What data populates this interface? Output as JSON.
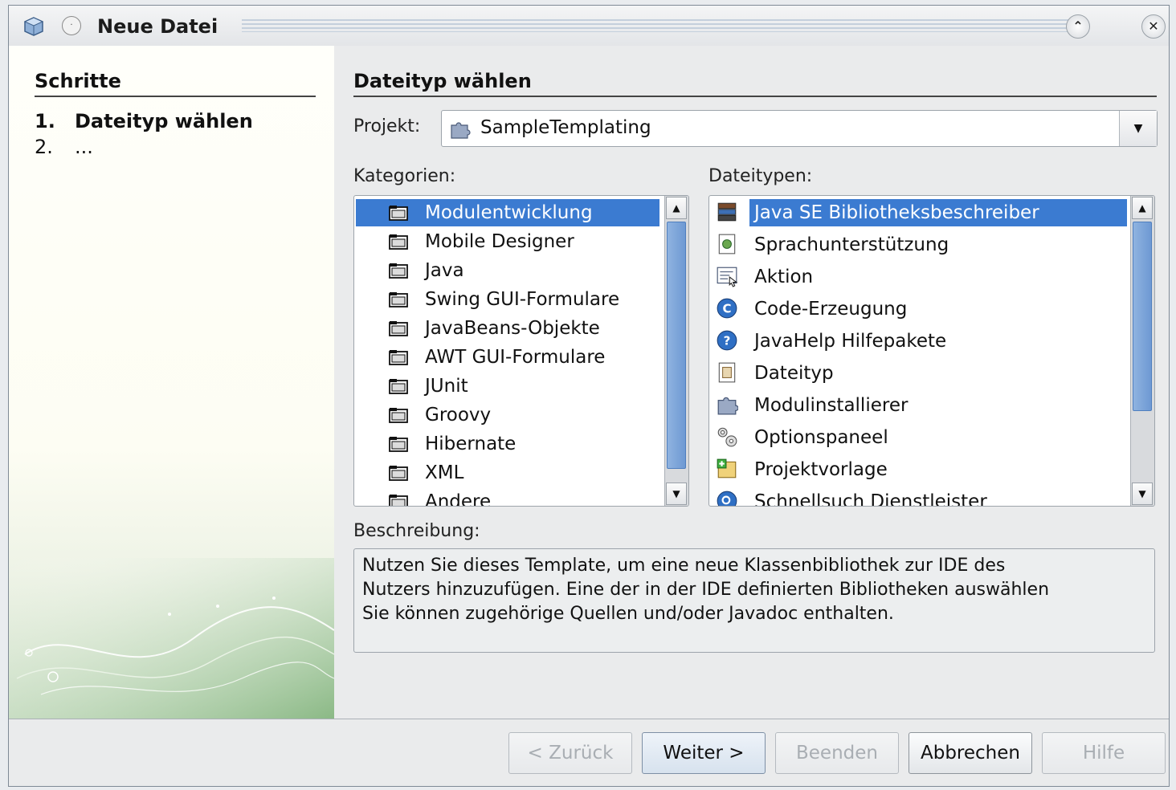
{
  "window": {
    "title": "Neue Datei",
    "minimize_symbol": "⌃",
    "close_symbol": "✕",
    "menu_symbol": "·"
  },
  "steps": {
    "heading": "Schritte",
    "items": [
      {
        "num": "1.",
        "label": "Dateityp wählen",
        "current": true
      },
      {
        "num": "2.",
        "label": "...",
        "current": false
      }
    ]
  },
  "main": {
    "heading": "Dateityp wählen",
    "project_label": "Projekt:",
    "project_value": "SampleTemplating",
    "categories_label": "Kategorien:",
    "categories": [
      "Modulentwicklung",
      "Mobile Designer",
      "Java",
      "Swing GUI-Formulare",
      "JavaBeans-Objekte",
      "AWT GUI-Formulare",
      "JUnit",
      "Groovy",
      "Hibernate",
      "XML",
      "Andere"
    ],
    "selected_category": "Modulentwicklung",
    "filetypes_label": "Dateitypen:",
    "filetypes": [
      {
        "label": "Java SE Bibliotheksbeschreiber",
        "icon": "books-icon"
      },
      {
        "label": "Sprachunterstützung",
        "icon": "language-file-icon"
      },
      {
        "label": "Aktion",
        "icon": "action-icon"
      },
      {
        "label": "Code-Erzeugung",
        "icon": "code-generator-icon"
      },
      {
        "label": "JavaHelp Hilfepakete",
        "icon": "help-icon"
      },
      {
        "label": "Dateityp",
        "icon": "file-type-icon"
      },
      {
        "label": "Modulinstallierer",
        "icon": "puzzle-icon"
      },
      {
        "label": "Optionspaneel",
        "icon": "options-icon"
      },
      {
        "label": "Projektvorlage",
        "icon": "project-template-icon"
      },
      {
        "label": "Schnellsuch Dienstleister",
        "icon": "quick-search-icon"
      }
    ],
    "selected_filetype": "Java SE Bibliotheksbeschreiber",
    "description_label": "Beschreibung:",
    "description_lines": [
      "Nutzen Sie dieses Template, um eine neue Klassenbibliothek zur IDE des",
      "Nutzers hinzuzufügen. Eine der in der IDE definierten Bibliotheken auswählen",
      "Sie können zugehörige Quellen und/oder Javadoc enthalten."
    ]
  },
  "buttons": {
    "back": "< Zurück",
    "next": "Weiter >",
    "finish": "Beenden",
    "cancel": "Abbrechen",
    "help": "Hilfe"
  },
  "colors": {
    "selection": "#3b7bd1",
    "scroll_thumb": "#6e99d3"
  }
}
